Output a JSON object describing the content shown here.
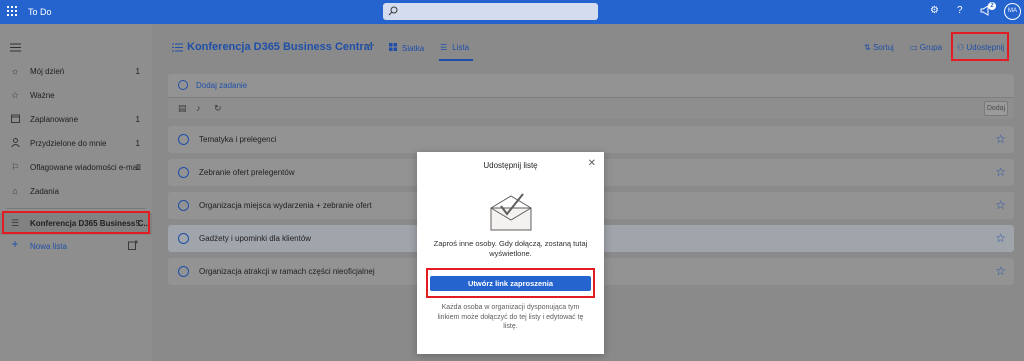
{
  "app": {
    "title": "To Do",
    "avatar_initials": "MA",
    "notification_count": "2"
  },
  "sidebar": {
    "items": [
      {
        "icon": "sun-icon",
        "label": "Mój dzień",
        "count": "1"
      },
      {
        "icon": "star-icon",
        "label": "Ważne",
        "count": ""
      },
      {
        "icon": "calendar-icon",
        "label": "Zaplanowane",
        "count": "1"
      },
      {
        "icon": "person-icon",
        "label": "Przydzielone do mnie",
        "count": "1"
      },
      {
        "icon": "flag-icon",
        "label": "Oflagowane wiadomości e-mail",
        "count": "1"
      },
      {
        "icon": "home-icon",
        "label": "Zadania",
        "count": ""
      }
    ],
    "active_list": {
      "label": "Konferencja D365 Business C...",
      "count": "5"
    },
    "new_list_label": "Nowa lista"
  },
  "header": {
    "list_title": "Konferencja D365 Business Central",
    "more": "···",
    "tabs": [
      {
        "label": "Siatka"
      },
      {
        "label": "Lista"
      }
    ],
    "actions": {
      "sort": "Sortuj",
      "group": "Grupa",
      "share": "Udostępnij"
    }
  },
  "add_task": {
    "placeholder": "Dodaj zadanie",
    "add_button": "Dodaj"
  },
  "tasks": [
    {
      "label": "Tematyka i prelegenci"
    },
    {
      "label": "Zebranie ofert prelegentów"
    },
    {
      "label": "Organizacja miejsca wydarzenia + zebranie ofert"
    },
    {
      "label": "Gadżety i upominki dla klientów"
    },
    {
      "label": "Organizacja atrakcji w ramach części nieoficjalnej"
    }
  ],
  "dialog": {
    "title": "Udostępnij listę",
    "close": "✕",
    "message": "Zaproś inne osoby. Gdy dołączą, zostaną tutaj wyświetlone.",
    "button": "Utwórz link zaproszenia",
    "note": "Każda osoba w organizacji dysponująca tym linkiem może dołączyć do tej listy i edytować tę listę."
  },
  "colors": {
    "brand": "#2564cf",
    "highlight": "#e31b23"
  }
}
